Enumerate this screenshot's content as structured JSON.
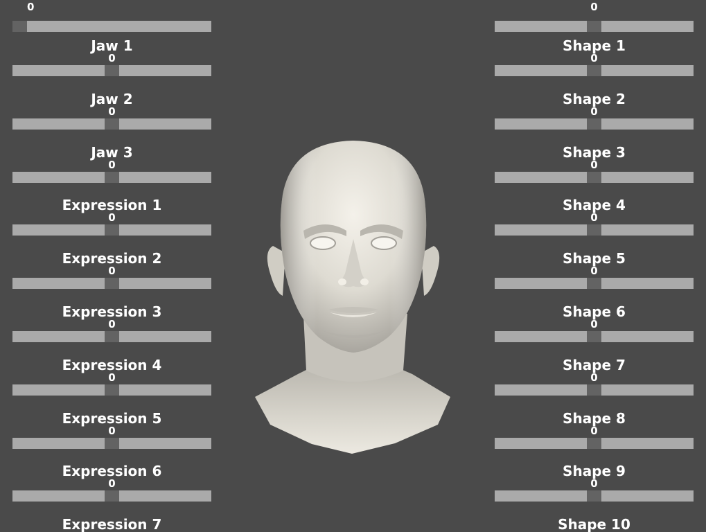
{
  "top_left": {
    "value": "0",
    "slider_level": 0.0
  },
  "top_right": {
    "value": "0",
    "slider_level": 0.5
  },
  "left_sliders": [
    {
      "label": "Jaw 1",
      "value": "0",
      "slider_level": 0.5
    },
    {
      "label": "Jaw 2",
      "value": "0",
      "slider_level": 0.5
    },
    {
      "label": "Jaw 3",
      "value": "0",
      "slider_level": 0.5
    },
    {
      "label": "Expression 1",
      "value": "0",
      "slider_level": 0.5
    },
    {
      "label": "Expression 2",
      "value": "0",
      "slider_level": 0.5
    },
    {
      "label": "Expression 3",
      "value": "0",
      "slider_level": 0.5
    },
    {
      "label": "Expression 4",
      "value": "0",
      "slider_level": 0.5
    },
    {
      "label": "Expression 5",
      "value": "0",
      "slider_level": 0.5
    },
    {
      "label": "Expression 6",
      "value": "0",
      "slider_level": 0.5
    },
    {
      "label": "Expression 7"
    }
  ],
  "right_sliders": [
    {
      "label": "Shape 1",
      "value": "0",
      "slider_level": 0.5
    },
    {
      "label": "Shape 2",
      "value": "0",
      "slider_level": 0.5
    },
    {
      "label": "Shape 3",
      "value": "0",
      "slider_level": 0.5
    },
    {
      "label": "Shape 4",
      "value": "0",
      "slider_level": 0.5
    },
    {
      "label": "Shape 5",
      "value": "0",
      "slider_level": 0.5
    },
    {
      "label": "Shape 6",
      "value": "0",
      "slider_level": 0.5
    },
    {
      "label": "Shape 7",
      "value": "0",
      "slider_level": 0.5
    },
    {
      "label": "Shape 8",
      "value": "0",
      "slider_level": 0.5
    },
    {
      "label": "Shape 9",
      "value": "0",
      "slider_level": 0.5
    },
    {
      "label": "Shape 10"
    }
  ],
  "colors": {
    "background": "#4a4a4a",
    "slider_track": "#aaaaaa",
    "slider_thumb": "#636363",
    "mesh": "#e8e4da"
  }
}
